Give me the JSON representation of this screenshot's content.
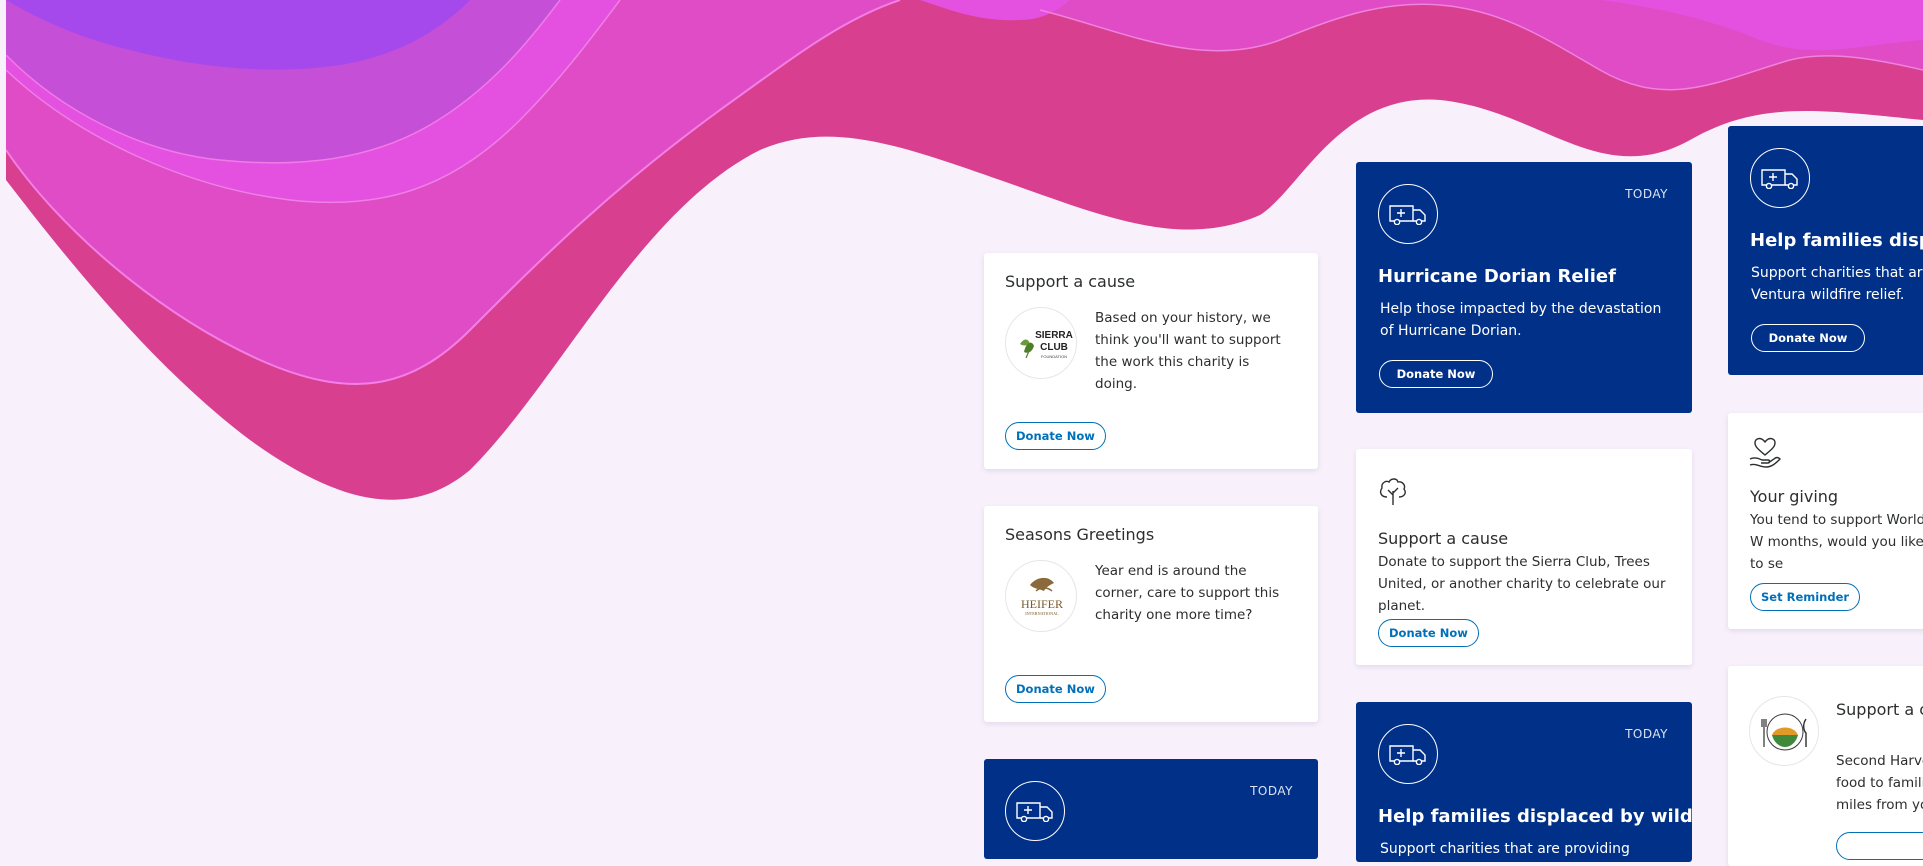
{
  "cards": {
    "sierra": {
      "title": "Support a cause",
      "body": "Based on your history, we think you'll want to support the work this charity is doing.",
      "logo_lines": [
        "SIERRA",
        "CLUB",
        "FOUNDATION"
      ],
      "button": "Donate Now"
    },
    "heifer": {
      "title": "Seasons Greetings",
      "body": "Year end is around the corner, care to support this charity one more time?",
      "logo_lines": [
        "HEIFER",
        "INTERNATIONAL"
      ],
      "button": "Donate Now"
    },
    "wildfire_bottom_left": {
      "badge": "TODAY"
    },
    "dorian": {
      "badge": "TODAY",
      "title": "Hurricane Dorian Relief",
      "body": "Help those impacted by the devastation of Hurricane Dorian.",
      "button": "Donate Now"
    },
    "planet": {
      "title": "Support a cause",
      "body": "Donate to support the Sierra Club, Trees United, or another charity to celebrate our planet.",
      "button": "Donate Now"
    },
    "wildfire_mid": {
      "badge": "TODAY",
      "title": "Help families displaced by wildfire",
      "body": "Support charities that are providing wildfire relief."
    },
    "wildfire_right": {
      "title": "Help families displace",
      "body": "Support charities that are Ventura wildfire relief.",
      "button": "Donate Now"
    },
    "giving": {
      "title": "Your giving",
      "body": "You tend to support World W months, would you like to se",
      "button": "Set Reminder"
    },
    "harvest": {
      "title": "Support a ca",
      "body": "Second Harves food to familie miles from you"
    }
  },
  "colors": {
    "page_bg": "#f8f1fb",
    "card_blue": "#003087",
    "link_blue": "#0070ba",
    "wave_purple": "#a548ec",
    "wave_magenta": "#e14ddd",
    "wave_pink": "#d83f96"
  }
}
